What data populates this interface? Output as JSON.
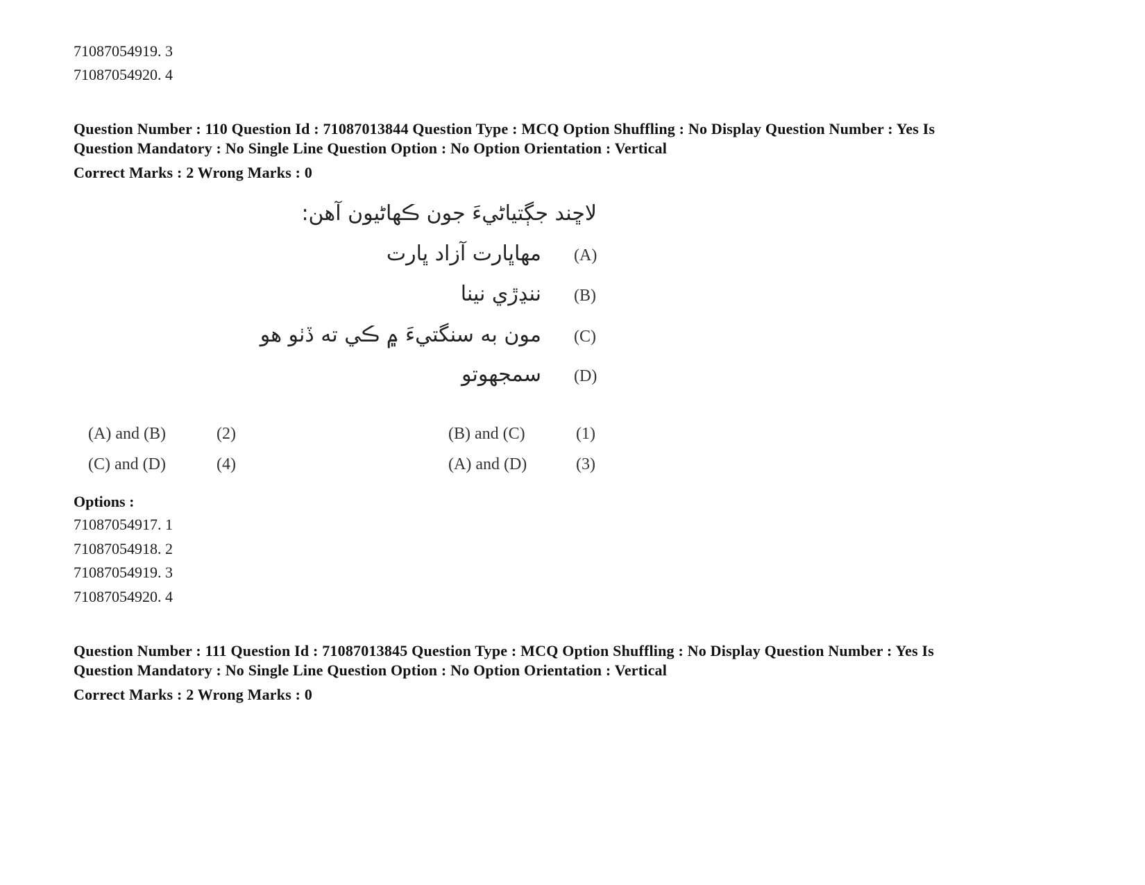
{
  "prev_options": [
    "71087054919. 3",
    "71087054920. 4"
  ],
  "question_110": {
    "meta_line1": "Question Number : 110 Question Id : 71087013844 Question Type : MCQ Option Shuffling : No Display Question Number : Yes Is",
    "meta_line2": "Question Mandatory : No Single Line Question Option : No Option Orientation : Vertical",
    "marks": "Correct Marks : 2 Wrong Marks : 0",
    "prompt": "لاڇند جڳتياڻيءَ جون ڪهاڻيون آهن:",
    "items": [
      {
        "label": "(A)",
        "text": "مهاڀارت آزاد ڀارت"
      },
      {
        "label": "(B)",
        "text": "ننڍڙي نينا"
      },
      {
        "label": "(C)",
        "text": "مون به سنگتيءَ ۾ ڪي ته ڏٺو هو"
      },
      {
        "label": "(D)",
        "text": "سمجهوتو"
      }
    ],
    "choices": [
      {
        "text": "(A) and (B)",
        "num": "(2)"
      },
      {
        "text": "(B) and (C)",
        "num": "(1)"
      },
      {
        "text": "(C) and (D)",
        "num": "(4)"
      },
      {
        "text": "(A) and (D)",
        "num": "(3)"
      }
    ],
    "options_heading": "Options :",
    "options": [
      "71087054917. 1",
      "71087054918. 2",
      "71087054919. 3",
      "71087054920. 4"
    ]
  },
  "question_111": {
    "meta_line1": "Question Number : 111 Question Id : 71087013845 Question Type : MCQ Option Shuffling : No Display Question Number : Yes Is",
    "meta_line2": "Question Mandatory : No Single Line Question Option : No Option Orientation : Vertical",
    "marks": "Correct Marks : 2 Wrong Marks : 0"
  }
}
